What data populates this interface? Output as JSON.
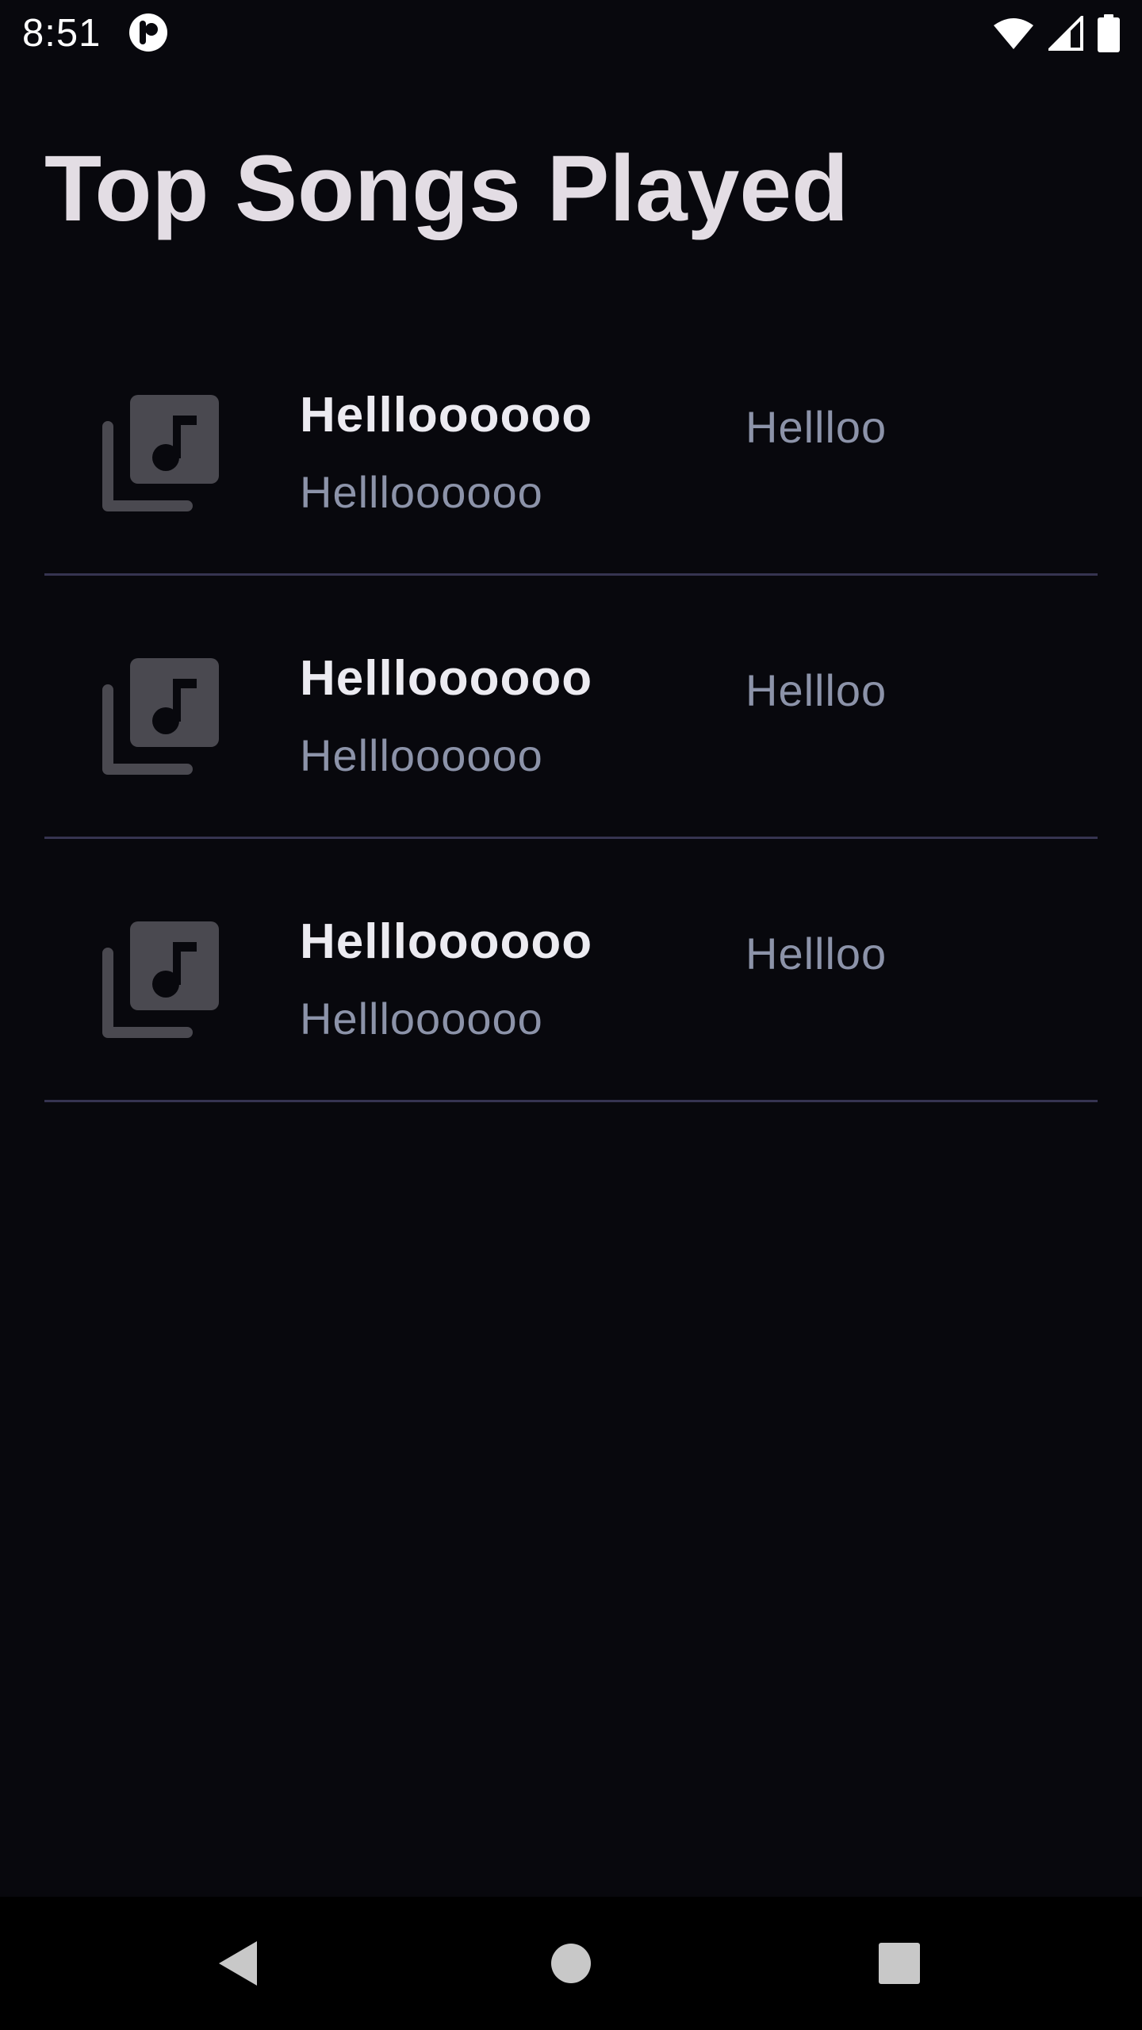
{
  "status_bar": {
    "time": "8:51",
    "icons": [
      "app-notification-icon",
      "wifi-icon",
      "signal-icon",
      "battery-icon"
    ]
  },
  "page": {
    "title": "Top Songs Played"
  },
  "songs": [
    {
      "title": "Hellloooooo",
      "subtitle": "Hellloooooo",
      "meta": "Hellloo",
      "icon": "music-library-icon"
    },
    {
      "title": "Hellloooooo",
      "subtitle": "Hellloooooo",
      "meta": "Hellloo",
      "icon": "music-library-icon"
    },
    {
      "title": "Hellloooooo",
      "subtitle": "Hellloooooo",
      "meta": "Hellloo",
      "icon": "music-library-icon"
    }
  ],
  "nav_bar": {
    "buttons": [
      "back-icon",
      "home-icon",
      "recents-icon"
    ]
  },
  "colors": {
    "background": "#08080d",
    "title": "#e3dde4",
    "song_title": "#ecebf1",
    "secondary_text": "#8c93a9",
    "divider": "#363451",
    "icon": "#4a4950"
  }
}
